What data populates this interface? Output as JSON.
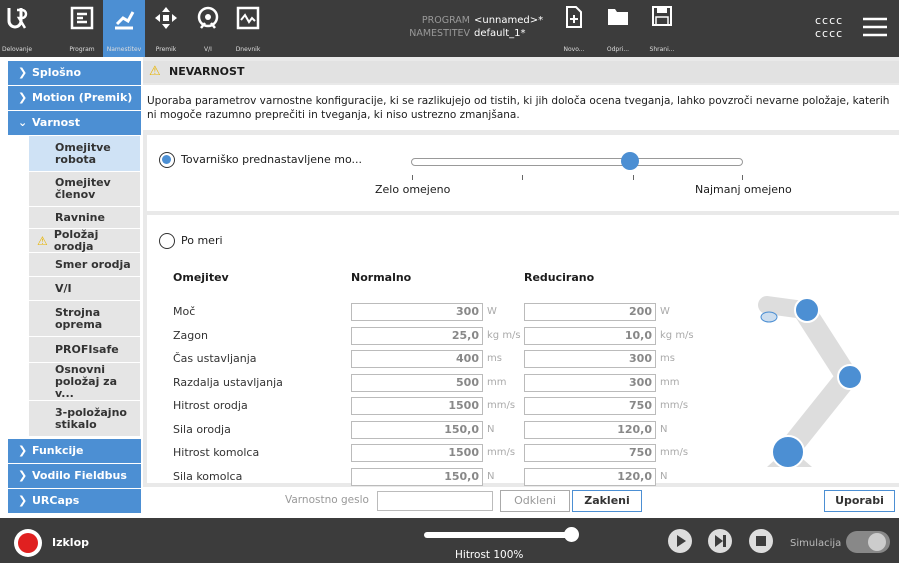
{
  "topbar": {
    "tabs": [
      {
        "label": "Delovanje",
        "icon": "ur-logo-icon"
      },
      {
        "label": "Program",
        "icon": "program-icon"
      },
      {
        "label": "Namestitev",
        "icon": "installation-icon"
      },
      {
        "label": "Premik",
        "icon": "move-icon"
      },
      {
        "label": "V/I",
        "icon": "io-icon"
      },
      {
        "label": "Dnevnik",
        "icon": "log-icon"
      }
    ],
    "program_key": "PROGRAM",
    "program_val": "<unnamed>*",
    "install_key": "NAMESTITEV",
    "install_val": "default_1*",
    "file_buttons": [
      {
        "label": "Novo...",
        "icon": "new-file-icon"
      },
      {
        "label": "Odpri...",
        "icon": "open-folder-icon"
      },
      {
        "label": "Shrani...",
        "icon": "save-icon"
      }
    ],
    "user_line1": "cccc",
    "user_line2": "cccc",
    "menu_icon": "hamburger-menu-icon"
  },
  "sidebar": {
    "headers": [
      "Splošno",
      "Motion (Premik)",
      "Varnost",
      "Funkcije",
      "Vodilo Fieldbus",
      "URCaps"
    ],
    "items": [
      {
        "label": "Omejitve robota",
        "selected": true,
        "warning": false
      },
      {
        "label": "Omejitev členov",
        "selected": false,
        "warning": false
      },
      {
        "label": "Ravnine",
        "selected": false,
        "warning": false
      },
      {
        "label": "Položaj orodja",
        "selected": false,
        "warning": true
      },
      {
        "label": "Smer orodja",
        "selected": false,
        "warning": false
      },
      {
        "label": "V/I",
        "selected": false,
        "warning": false
      },
      {
        "label": "Strojna oprema",
        "selected": false,
        "warning": false
      },
      {
        "label": "PROFIsafe",
        "selected": false,
        "warning": false
      },
      {
        "label": "Osnovni položaj za v...",
        "selected": false,
        "warning": false
      },
      {
        "label": "3-položajno stikalo",
        "selected": false,
        "warning": false
      }
    ]
  },
  "warning": {
    "title": "NEVARNOST",
    "text": "Uporaba parametrov varnostne konfiguracije, ki se razlikujejo od tistih, ki jih določa ocena tveganja, lahko povzroči nevarne položaje, katerih ni mogoče razumno preprečiti in tveganja, ki niso ustrezno zmanjšana.",
    "accent": "#f5c518"
  },
  "preset": {
    "radio_label": "Tovarniško prednastavljene mo...",
    "selected": true,
    "slider_left": "Zelo omejeno",
    "slider_right": "Najmanj omejeno",
    "slider_position_fraction": 0.66
  },
  "custom": {
    "radio_label": "Po meri",
    "selected": false,
    "col_limit": "Omejitev",
    "col_normal": "Normalno",
    "col_reduced": "Reducirano",
    "rows": [
      {
        "name": "Moč",
        "normal": "300",
        "reduced": "200",
        "unit": "W"
      },
      {
        "name": "Zagon",
        "normal": "25,0",
        "reduced": "10,0",
        "unit": "kg m/s"
      },
      {
        "name": "Čas ustavljanja",
        "normal": "400",
        "reduced": "300",
        "unit": "ms"
      },
      {
        "name": "Razdalja ustavljanja",
        "normal": "500",
        "reduced": "300",
        "unit": "mm"
      },
      {
        "name": "Hitrost orodja",
        "normal": "1500",
        "reduced": "750",
        "unit": "mm/s"
      },
      {
        "name": "Sila orodja",
        "normal": "150,0",
        "reduced": "120,0",
        "unit": "N"
      },
      {
        "name": "Hitrost komolca",
        "normal": "1500",
        "reduced": "750",
        "unit": "mm/s"
      },
      {
        "name": "Sila komolca",
        "normal": "150,0",
        "reduced": "120,0",
        "unit": "N"
      }
    ]
  },
  "actions": {
    "password_label": "Varnostno geslo",
    "password_value": "",
    "unlock": "Odkleni",
    "lock": "Zakleni",
    "apply": "Uporabi"
  },
  "footer": {
    "power_label": "Izklop",
    "speed_label": "Hitrost 100%",
    "speed_fraction": 1.0,
    "sim_label": "Simulacija",
    "power_color": "#e02020"
  },
  "colors": {
    "accent": "#4c8fd3",
    "topbar": "#3c3c3c"
  }
}
